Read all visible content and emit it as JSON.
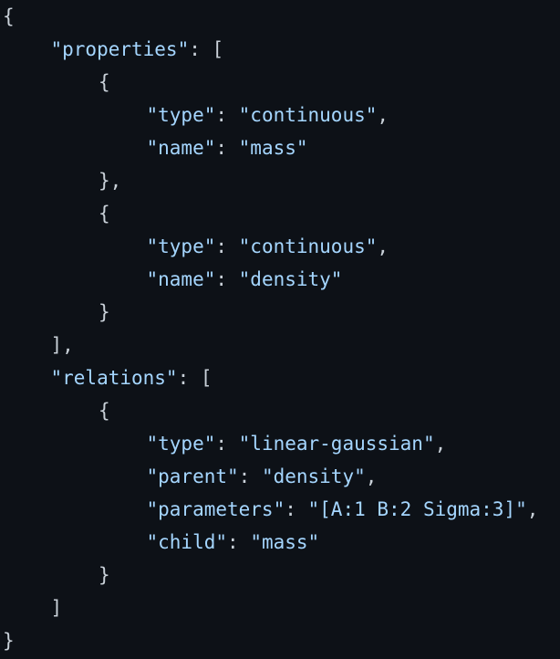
{
  "json_view": {
    "lines": [
      {
        "indent": 0,
        "parts": [
          {
            "t": "{",
            "c": "punc"
          }
        ]
      },
      {
        "indent": 1,
        "parts": [
          {
            "t": "\"properties\"",
            "c": "str"
          },
          {
            "t": ": [",
            "c": "punc"
          }
        ]
      },
      {
        "indent": 2,
        "parts": [
          {
            "t": "{",
            "c": "punc"
          }
        ]
      },
      {
        "indent": 3,
        "parts": [
          {
            "t": "\"type\"",
            "c": "str"
          },
          {
            "t": ": ",
            "c": "punc"
          },
          {
            "t": "\"continuous\"",
            "c": "str"
          },
          {
            "t": ",",
            "c": "punc"
          }
        ]
      },
      {
        "indent": 3,
        "parts": [
          {
            "t": "\"name\"",
            "c": "str"
          },
          {
            "t": ": ",
            "c": "punc"
          },
          {
            "t": "\"mass\"",
            "c": "str"
          }
        ]
      },
      {
        "indent": 2,
        "parts": [
          {
            "t": "},",
            "c": "punc"
          }
        ]
      },
      {
        "indent": 2,
        "parts": [
          {
            "t": "{",
            "c": "punc"
          }
        ]
      },
      {
        "indent": 3,
        "parts": [
          {
            "t": "\"type\"",
            "c": "str"
          },
          {
            "t": ": ",
            "c": "punc"
          },
          {
            "t": "\"continuous\"",
            "c": "str"
          },
          {
            "t": ",",
            "c": "punc"
          }
        ]
      },
      {
        "indent": 3,
        "parts": [
          {
            "t": "\"name\"",
            "c": "str"
          },
          {
            "t": ": ",
            "c": "punc"
          },
          {
            "t": "\"density\"",
            "c": "str"
          }
        ]
      },
      {
        "indent": 2,
        "parts": [
          {
            "t": "}",
            "c": "punc"
          }
        ]
      },
      {
        "indent": 1,
        "parts": [
          {
            "t": "],",
            "c": "punc"
          }
        ]
      },
      {
        "indent": 1,
        "parts": [
          {
            "t": "\"relations\"",
            "c": "str"
          },
          {
            "t": ": [",
            "c": "punc"
          }
        ]
      },
      {
        "indent": 2,
        "parts": [
          {
            "t": "{",
            "c": "punc"
          }
        ]
      },
      {
        "indent": 3,
        "parts": [
          {
            "t": "\"type\"",
            "c": "str"
          },
          {
            "t": ": ",
            "c": "punc"
          },
          {
            "t": "\"linear-gaussian\"",
            "c": "str"
          },
          {
            "t": ",",
            "c": "punc"
          }
        ]
      },
      {
        "indent": 3,
        "parts": [
          {
            "t": "\"parent\"",
            "c": "str"
          },
          {
            "t": ": ",
            "c": "punc"
          },
          {
            "t": "\"density\"",
            "c": "str"
          },
          {
            "t": ",",
            "c": "punc"
          }
        ]
      },
      {
        "indent": 3,
        "parts": [
          {
            "t": "\"parameters\"",
            "c": "str"
          },
          {
            "t": ": ",
            "c": "punc"
          },
          {
            "t": "\"[A:1 B:2 Sigma:3]\"",
            "c": "str"
          },
          {
            "t": ",",
            "c": "punc"
          }
        ]
      },
      {
        "indent": 3,
        "parts": [
          {
            "t": "\"child\"",
            "c": "str"
          },
          {
            "t": ": ",
            "c": "punc"
          },
          {
            "t": "\"mass\"",
            "c": "str"
          }
        ]
      },
      {
        "indent": 2,
        "parts": [
          {
            "t": "}",
            "c": "punc"
          }
        ]
      },
      {
        "indent": 1,
        "parts": [
          {
            "t": "]",
            "c": "punc"
          }
        ]
      },
      {
        "indent": 0,
        "parts": [
          {
            "t": "}",
            "c": "punc"
          }
        ]
      }
    ]
  }
}
